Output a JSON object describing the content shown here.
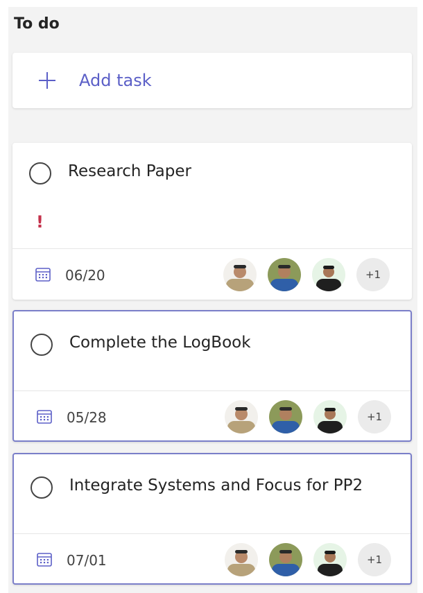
{
  "column": {
    "title": "To do"
  },
  "add_task": {
    "label": "Add task",
    "icon": "plus-icon"
  },
  "tasks": [
    {
      "title": "Research Paper",
      "priority": "!",
      "priority_icon": "urgent-icon",
      "due": "06/20",
      "extra_assignees": "+1",
      "selected": false
    },
    {
      "title": "Complete the LogBook",
      "due": "05/28",
      "extra_assignees": "+1",
      "selected": true
    },
    {
      "title": "Integrate Systems and Focus for PP2",
      "due": "07/01",
      "extra_assignees": "+1",
      "selected": true
    }
  ],
  "colors": {
    "accent": "#5b5fc7",
    "urgent": "#c4314b",
    "selected_border": "#7a7ec9",
    "column_bg": "#f3f3f3"
  }
}
